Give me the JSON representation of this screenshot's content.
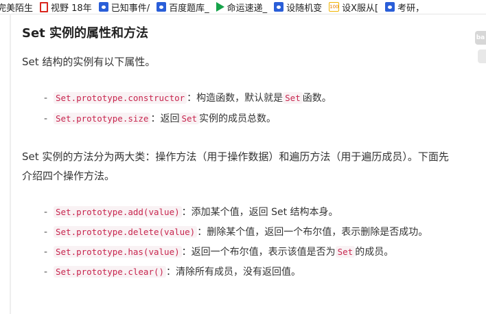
{
  "bookmarks": [
    {
      "icon": "none",
      "label": "完美陌生"
    },
    {
      "icon": "red-rect",
      "label": "视野 18年"
    },
    {
      "icon": "paw",
      "label": "已知事件/"
    },
    {
      "icon": "paw",
      "label": "百度题库_"
    },
    {
      "icon": "play",
      "label": "命运速递_"
    },
    {
      "icon": "paw",
      "label": "设随机变"
    },
    {
      "icon": "num",
      "label": "设X服从["
    },
    {
      "icon": "paw",
      "label": "考研，"
    }
  ],
  "side_tab": {
    "label": "ba"
  },
  "article": {
    "heading": "Set 实例的属性和方法",
    "intro": "Set 结构的实例有以下属性。",
    "properties": [
      {
        "code": "Set.prototype.constructor",
        "sep": "：",
        "text_before": "构造函数，默认就是",
        "code2": "Set",
        "text_after": "函数。"
      },
      {
        "code": "Set.prototype.size",
        "sep": "：",
        "text_before": "返回",
        "code2": "Set",
        "text_after": "实例的成员总数。"
      }
    ],
    "methods_intro": "Set 实例的方法分为两大类：操作方法（用于操作数据）和遍历方法（用于遍历成员）。下面先介绍四个操作方法。",
    "methods": [
      {
        "code": "Set.prototype.add(value)",
        "sep": "：",
        "text_before": "添加某个值，返回 Set 结构本身。",
        "code2": "",
        "text_after": ""
      },
      {
        "code": "Set.prototype.delete(value)",
        "sep": "：",
        "text_before": "删除某个值，返回一个布尔值，表示删除是否成功。",
        "code2": "",
        "text_after": ""
      },
      {
        "code": "Set.prototype.has(value)",
        "sep": "：",
        "text_before": "返回一个布尔值，表示该值是否为",
        "code2": "Set",
        "text_after": "的成员。"
      },
      {
        "code": "Set.prototype.clear()",
        "sep": "：",
        "text_before": "清除所有成员，没有返回值。",
        "code2": "",
        "text_after": ""
      }
    ]
  }
}
